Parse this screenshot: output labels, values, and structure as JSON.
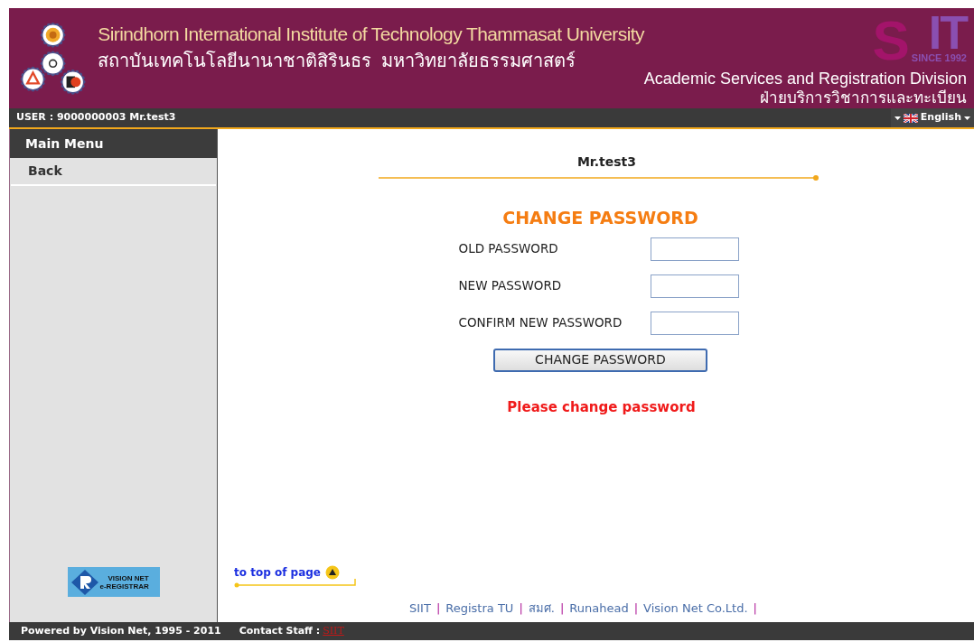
{
  "header": {
    "title_en": "Sirindhorn International Institute of Technology Thammasat University",
    "title_th": "สถาบันเทคโนโลยีนานาชาติสิรินธร  มหาวิทยาลัยธรรมศาสตร์",
    "logo": {
      "letter_s": "S",
      "letters_it": "IT",
      "since": "SINCE 1992"
    },
    "division_en": "Academic Services and Registration Division",
    "division_th": "ฝ่ายบริการวิชาการและทะเบียน"
  },
  "user_bar": {
    "user": "USER : 9000000003 Mr.test3",
    "language": "English"
  },
  "sidebar": {
    "heading": "Main Menu",
    "items": [
      {
        "label": "Back"
      }
    ],
    "badge": {
      "line1": "VISION NET",
      "line2": "e-REGISTRAR"
    }
  },
  "main": {
    "user_name": "Mr.test3",
    "title": "CHANGE PASSWORD",
    "fields": [
      {
        "label": "OLD PASSWORD"
      },
      {
        "label": "NEW PASSWORD"
      },
      {
        "label": "CONFIRM NEW PASSWORD"
      }
    ],
    "submit": "CHANGE PASSWORD",
    "message": "Please change password",
    "to_top": "to top of page",
    "links": [
      {
        "label": "SIIT"
      },
      {
        "label": "Registra TU"
      },
      {
        "label": "สมศ."
      },
      {
        "label": "Runahead"
      },
      {
        "label": "Vision Net Co.Ltd."
      }
    ],
    "separator": "|"
  },
  "footer": {
    "powered": "Powered by Vision Net, 1995 - 2011",
    "contact_label": "Contact Staff :",
    "contact_link": "SIIT"
  }
}
